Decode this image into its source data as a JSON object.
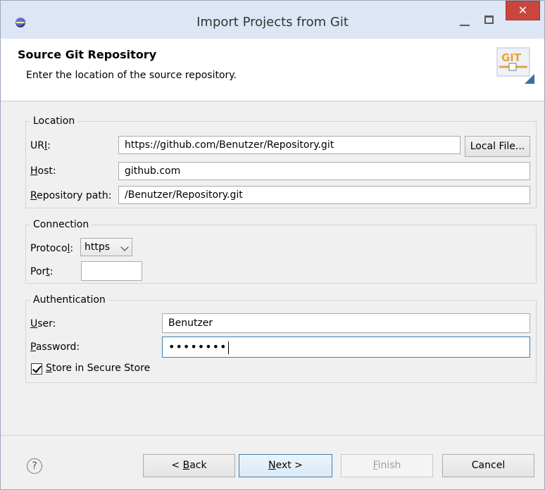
{
  "window": {
    "title": "Import Projects from Git",
    "close_glyph": "✕"
  },
  "header": {
    "title": "Source Git Repository",
    "description": "Enter the location of the source repository.",
    "logo_text": "GIT"
  },
  "location": {
    "group_label": "Location",
    "uri_label_pre": "UR",
    "uri_label_key": "I",
    "uri_label_post": ":",
    "uri_value": "https://github.com/Benutzer/Repository.git",
    "local_file_label": "Local File...",
    "host_label_key": "H",
    "host_label_rest": "ost:",
    "host_value": "github.com",
    "repo_label_key": "R",
    "repo_label_rest": "epository path:",
    "repo_value": "/Benutzer/Repository.git"
  },
  "connection": {
    "group_label": "Connection",
    "protocol_label_pre": "Protoco",
    "protocol_label_key": "l",
    "protocol_label_post": ":",
    "protocol_value": "https",
    "port_label_pre": "Por",
    "port_label_key": "t",
    "port_label_post": ":",
    "port_value": ""
  },
  "authentication": {
    "group_label": "Authentication",
    "user_label_key": "U",
    "user_label_rest": "ser:",
    "user_value": "Benutzer",
    "password_label_key": "P",
    "password_label_rest": "assword:",
    "password_value": "••••••••",
    "store_label_key": "S",
    "store_label_rest": "tore in Secure Store",
    "store_checked": true
  },
  "footer": {
    "help_glyph": "?",
    "back_pre": "< ",
    "back_key": "B",
    "back_rest": "ack",
    "next_key": "N",
    "next_rest": "ext >",
    "finish_key": "F",
    "finish_rest": "inish",
    "cancel_label": "Cancel"
  },
  "colors": {
    "title_bar": "#dce6f4",
    "close_red": "#c9463d",
    "focus_blue": "#3c7fb1",
    "git_orange": "#e8a33b"
  }
}
